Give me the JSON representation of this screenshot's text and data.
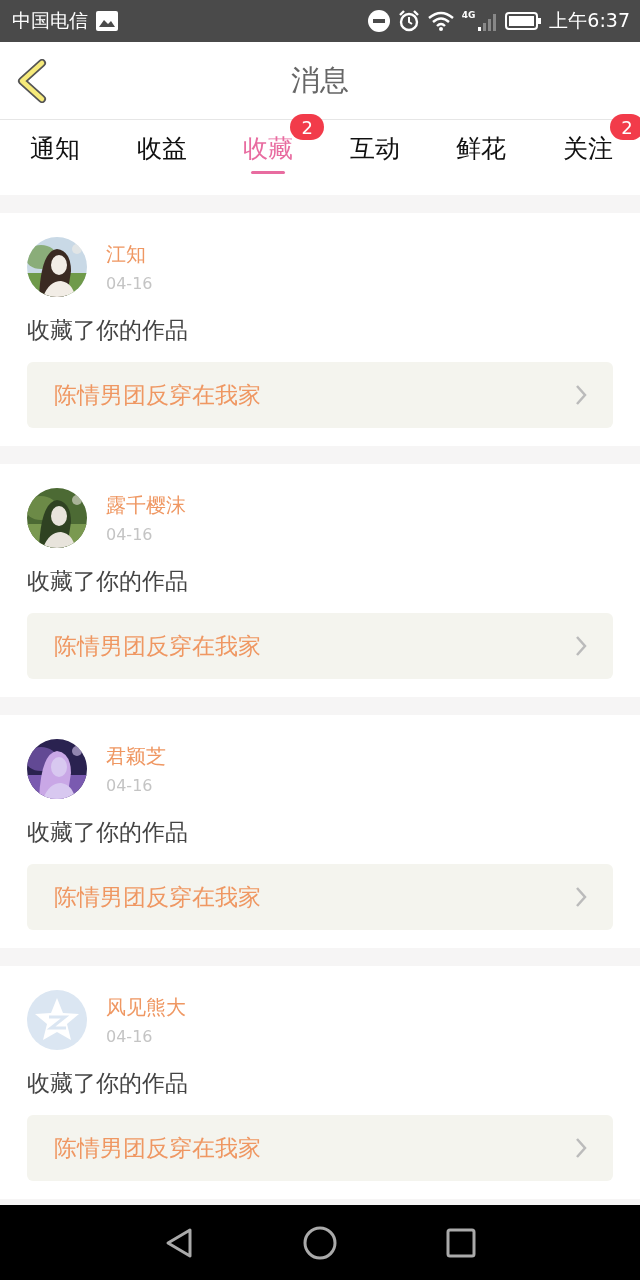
{
  "status_bar": {
    "carrier": "中国电信",
    "network": "4G",
    "time": "上午6:37"
  },
  "header": {
    "title": "消息"
  },
  "tabs": [
    {
      "label": "通知",
      "selected": false
    },
    {
      "label": "收益",
      "selected": false
    },
    {
      "label": "收藏",
      "selected": true,
      "badge": "2"
    },
    {
      "label": "互动",
      "selected": false
    },
    {
      "label": "鲜花",
      "selected": false
    },
    {
      "label": "关注",
      "selected": false,
      "badge": "2"
    }
  ],
  "messages": [
    {
      "name": "江知",
      "date": "04-16",
      "action": "收藏了你的作品",
      "work": "陈情男团反穿在我家"
    },
    {
      "name": "露千樱沫",
      "date": "04-16",
      "action": "收藏了你的作品",
      "work": "陈情男团反穿在我家"
    },
    {
      "name": "君颖芝",
      "date": "04-16",
      "action": "收藏了你的作品",
      "work": "陈情男团反穿在我家"
    },
    {
      "avatar": {
        "kind": "default"
      },
      "name": "风见熊大",
      "date": "04-16",
      "action": "收藏了你的作品",
      "work": "陈情男团反穿在我家"
    }
  ]
}
